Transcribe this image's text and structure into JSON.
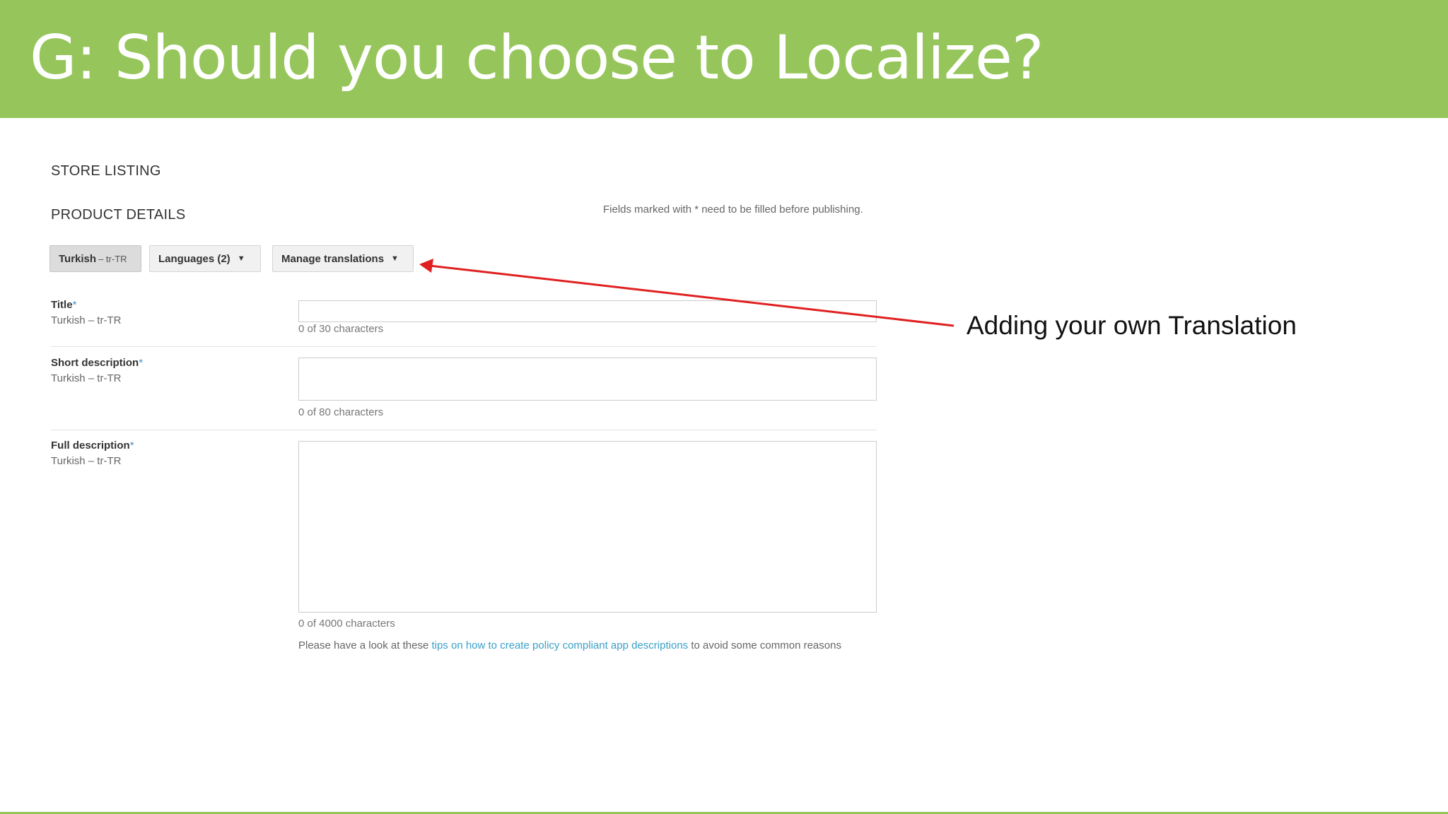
{
  "slide": {
    "title": "G: Should you choose to Localize?",
    "annotation": "Adding your own Translation"
  },
  "store": {
    "heading": "STORE LISTING",
    "product_heading": "PRODUCT DETAILS",
    "required_note": "Fields marked with * need to be filled before publishing.",
    "language_button": {
      "label": "Turkish",
      "code": "– tr-TR"
    },
    "languages_dropdown": "Languages (2)",
    "manage_dropdown": "Manage translations",
    "fields": [
      {
        "label": "Title",
        "required_mark": "*",
        "language": "Turkish – tr-TR",
        "value": "",
        "counter": "0 of 30 characters"
      },
      {
        "label": "Short description",
        "required_mark": "*",
        "language": "Turkish – tr-TR",
        "value": "",
        "counter": "0 of 80 characters"
      },
      {
        "label": "Full description",
        "required_mark": "*",
        "language": "Turkish – tr-TR",
        "value": "",
        "counter": "0 of 4000 characters"
      }
    ],
    "tip": {
      "prefix": "Please have a look at these ",
      "link": "tips on how to create policy compliant app descriptions",
      "suffix": " to avoid some common reasons"
    }
  },
  "colors": {
    "banner": "#96c65b",
    "arrow": "#e02020",
    "link": "#3aa0c8"
  },
  "icons": {
    "dropdown": "caret-down-icon",
    "annotation": "arrow-icon"
  }
}
